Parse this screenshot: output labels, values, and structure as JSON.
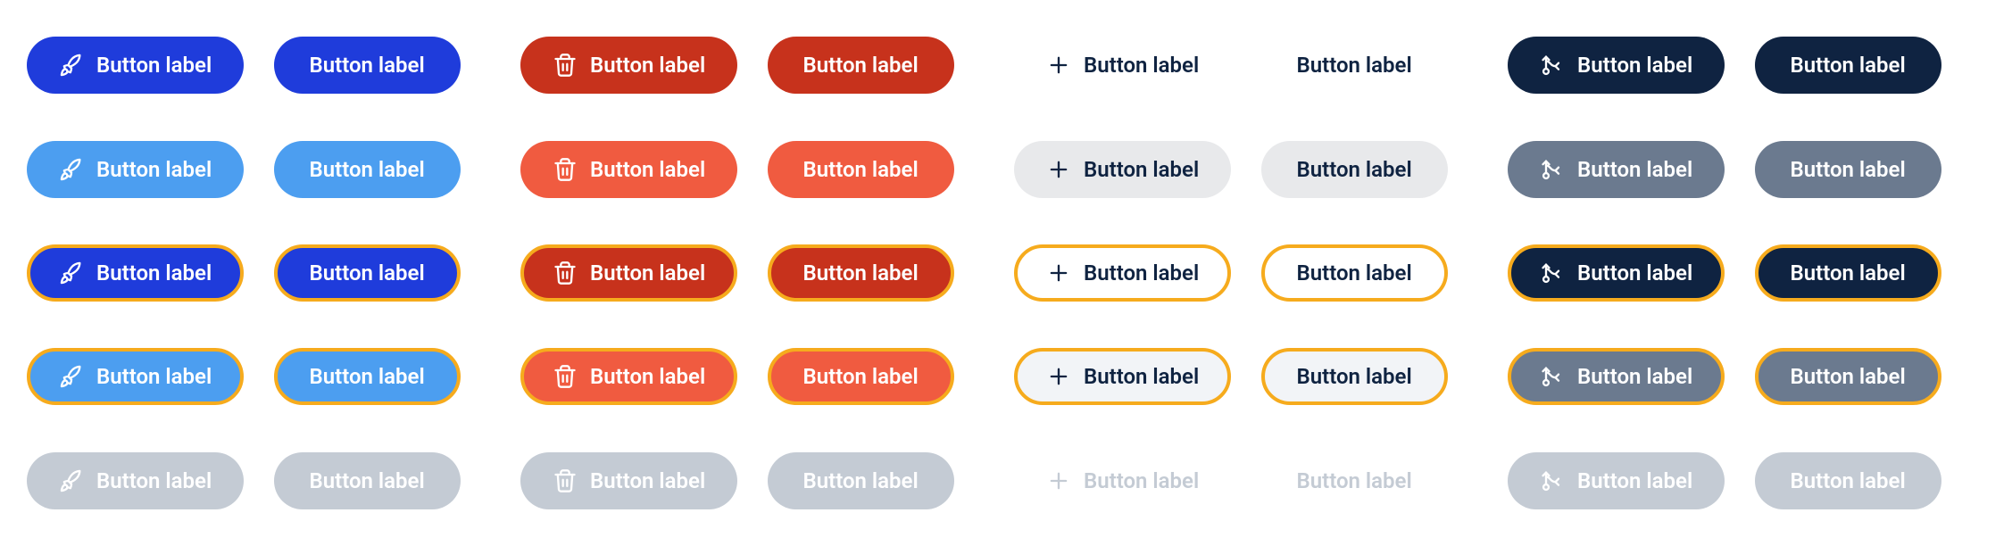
{
  "label": "Button label",
  "variants": [
    "primary",
    "danger",
    "ghost",
    "dark"
  ],
  "states": [
    "default",
    "hover",
    "focus",
    "focus-hover",
    "disabled"
  ],
  "icons": {
    "primary": "rocket",
    "danger": "trash",
    "ghost": "plus",
    "dark": "branch"
  },
  "colors": {
    "blue": "#1f3cdb",
    "blue_light": "#4c9ef0",
    "red": "#c7321c",
    "red_light": "#f05b40",
    "navy": "#0f2341",
    "grey": "#6b7a8f",
    "grey_bg": "#e8e9eb",
    "disabled": "#c4cbd4",
    "focus_ring": "#f6ab1d",
    "white": "#ffffff"
  }
}
